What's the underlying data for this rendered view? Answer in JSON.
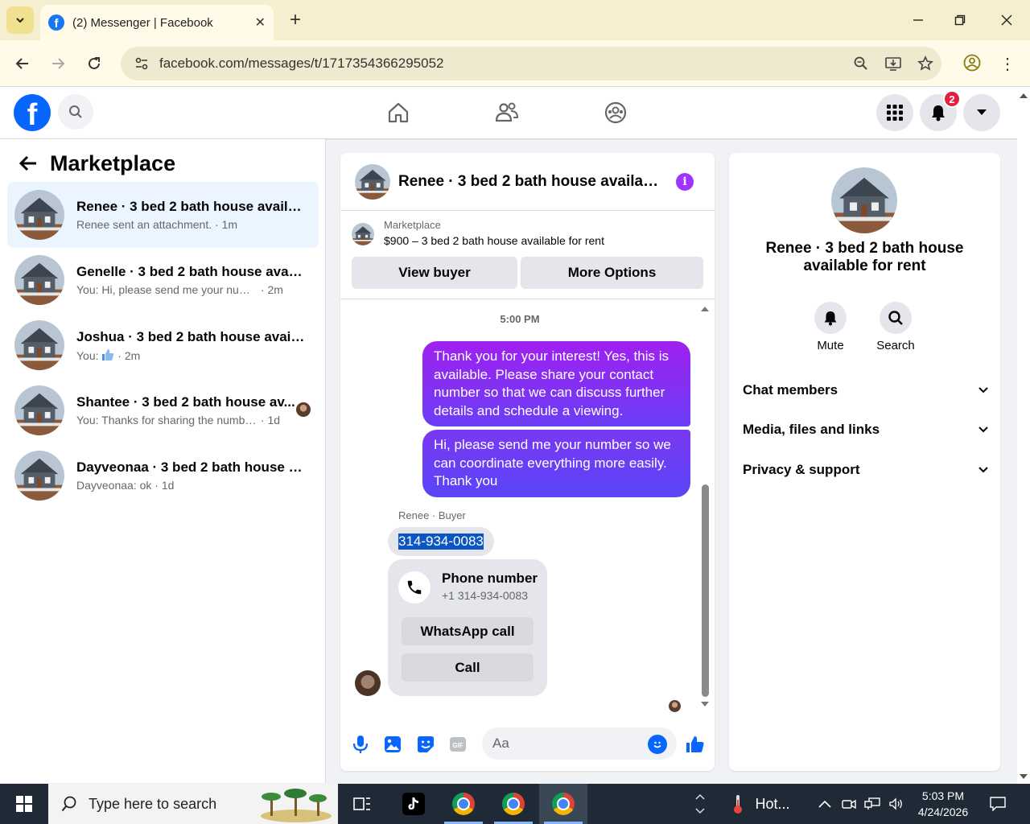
{
  "browser": {
    "tab_title": "(2) Messenger | Facebook",
    "url": "facebook.com/messages/t/1717354366295052"
  },
  "header": {
    "notification_count": "2"
  },
  "left_panel": {
    "title": "Marketplace",
    "conversations": [
      {
        "name": "Renee · 3 bed 2 bath house availa...",
        "snippet": "Renee sent an attachment.",
        "time": " · 1m",
        "active": true
      },
      {
        "name": "Genelle · 3 bed 2 bath house avail...",
        "snippet": "You: Hi, please send me your number...",
        "time": " · 2m"
      },
      {
        "name": "Joshua · 3 bed 2 bath house availa...",
        "snippet": "You: ",
        "time": " · 2m"
      },
      {
        "name": "Shantee · 3 bed 2 bath house av...",
        "snippet": "You: Thanks for sharing the numbe...",
        "time": " · 1d"
      },
      {
        "name": "Dayveonaa · 3 bed 2 bath house a...",
        "snippet": "Dayveonaa: ok",
        "time": " · 1d"
      }
    ]
  },
  "chat": {
    "title": "Renee · 3 bed 2 bath house availabl...",
    "marketplace_label": "Marketplace",
    "listing": "$900 – 3 bed 2 bath house available for rent",
    "view_buyer": "View buyer",
    "more_options": "More Options",
    "timestamp": "5:00 PM",
    "messages_out": [
      "Thank you for your interest! Yes, this is available. Please share your contact number so that we can discuss further details and schedule a viewing.",
      "Hi, please send me your number so we can coordinate everything more easily. Thank you"
    ],
    "sender_label": "Renee · Buyer",
    "phone_text": "314-934-0083",
    "phone_card": {
      "title": "Phone number",
      "number": "+1 314-934-0083",
      "whatsapp": "WhatsApp call",
      "call": "Call"
    },
    "input_placeholder": "Aa"
  },
  "right_panel": {
    "name": "Renee · 3 bed 2 bath house available for rent",
    "mute": "Mute",
    "search": "Search",
    "sections": [
      "Chat members",
      "Media, files and links",
      "Privacy & support"
    ]
  },
  "taskbar": {
    "search_placeholder": "Type here to search",
    "weather": "Hot...",
    "time": "5:03 PM",
    "date": "4/24/2026"
  },
  "colors": {
    "fb_blue": "#0866ff",
    "bubble_top": "#a020f0",
    "bubble_bottom": "#6a3ef5",
    "chrome_tabbar": "#f6efcf"
  }
}
